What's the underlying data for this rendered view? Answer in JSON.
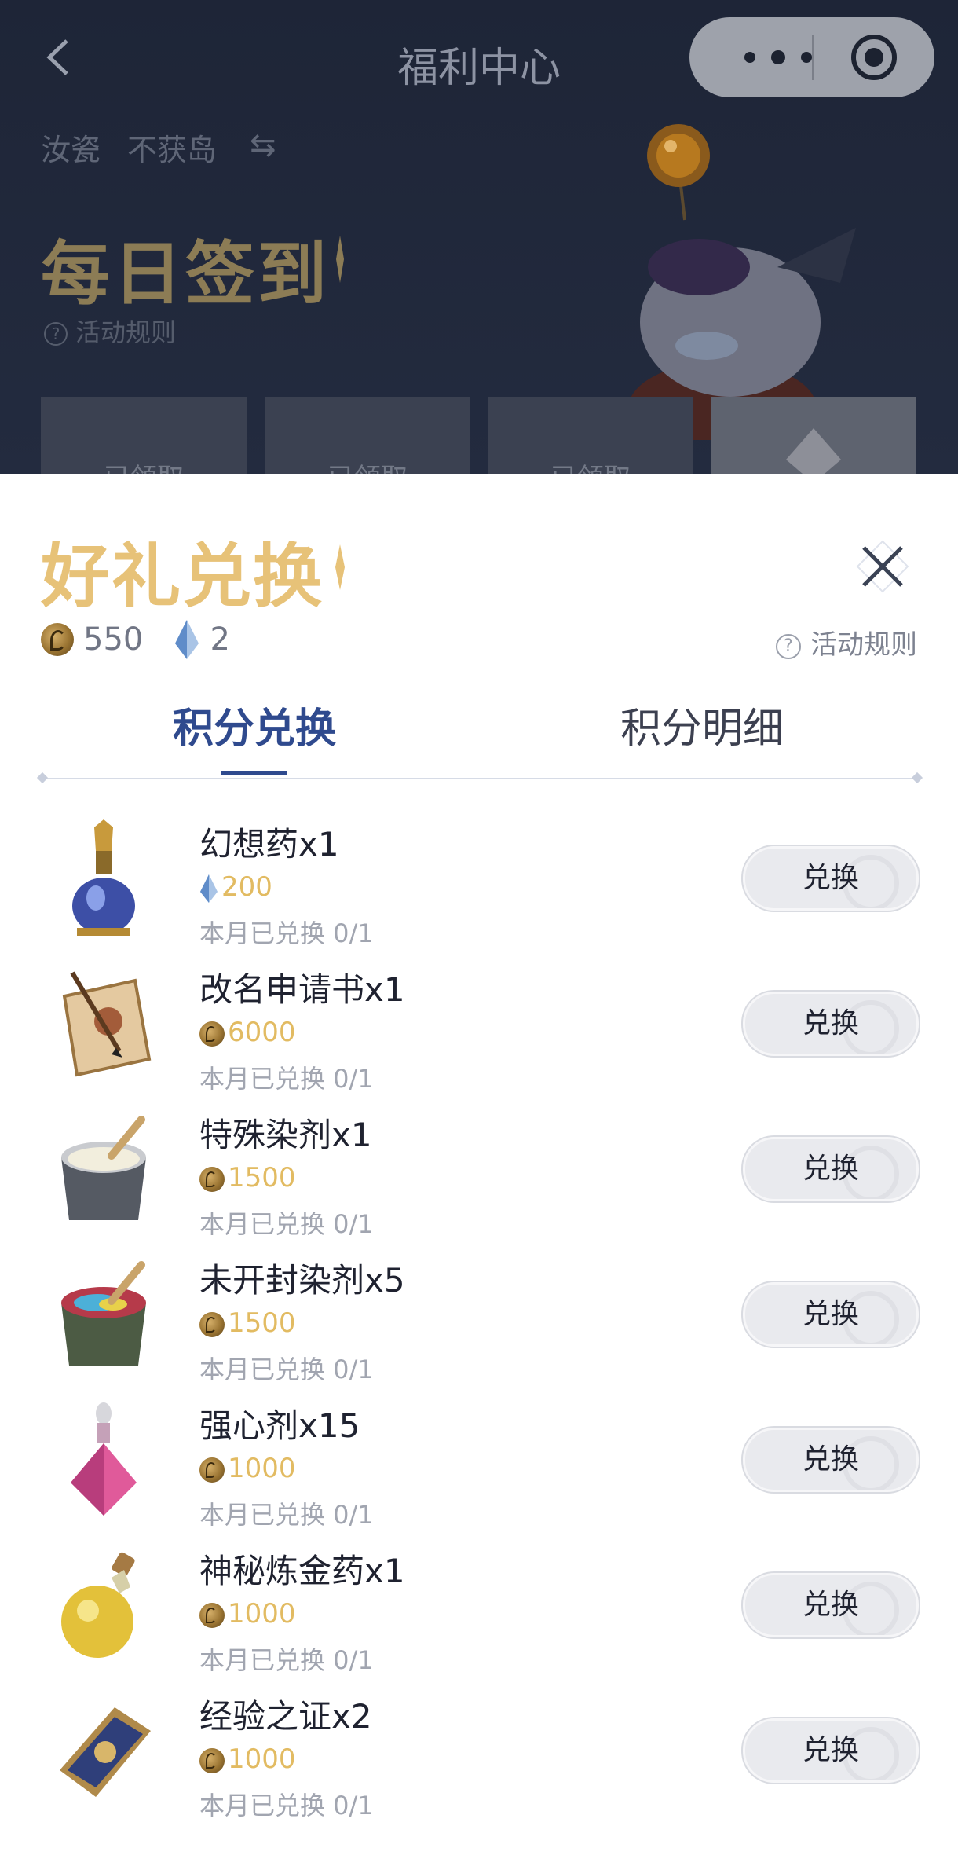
{
  "nav": {
    "title": "福利中心"
  },
  "account": {
    "server": "汝瓷",
    "world": "不获岛"
  },
  "daily": {
    "title": "每日签到",
    "rules_label": "活动规则",
    "cards": [
      "已领取",
      "已领取",
      "已领取",
      ""
    ]
  },
  "sheet": {
    "title": "好礼兑换",
    "rules_label": "活动规则",
    "balances": {
      "coins": "550",
      "crystals": "2"
    },
    "tabs": [
      {
        "label": "积分兑换",
        "active": true
      },
      {
        "label": "积分明细",
        "active": false
      }
    ],
    "button_label": "兑换",
    "items": [
      {
        "name": "幻想药x1",
        "currency": "crystal",
        "price": "200",
        "limit": "本月已兑换 0/1"
      },
      {
        "name": "改名申请书x1",
        "currency": "coin",
        "price": "6000",
        "limit": "本月已兑换 0/1"
      },
      {
        "name": "特殊染剂x1",
        "currency": "coin",
        "price": "1500",
        "limit": "本月已兑换 0/1"
      },
      {
        "name": "未开封染剂x5",
        "currency": "coin",
        "price": "1500",
        "limit": "本月已兑换 0/1"
      },
      {
        "name": "强心剂x15",
        "currency": "coin",
        "price": "1000",
        "limit": "本月已兑换 0/1"
      },
      {
        "name": "神秘炼金药x1",
        "currency": "coin",
        "price": "1000",
        "limit": "本月已兑换 0/1"
      },
      {
        "name": "经验之证x2",
        "currency": "coin",
        "price": "1000",
        "limit": "本月已兑换 0/1"
      }
    ]
  },
  "colors": {
    "accent": "#2f4a8e",
    "gold": "#e7c278",
    "price": "#e2bb62"
  }
}
